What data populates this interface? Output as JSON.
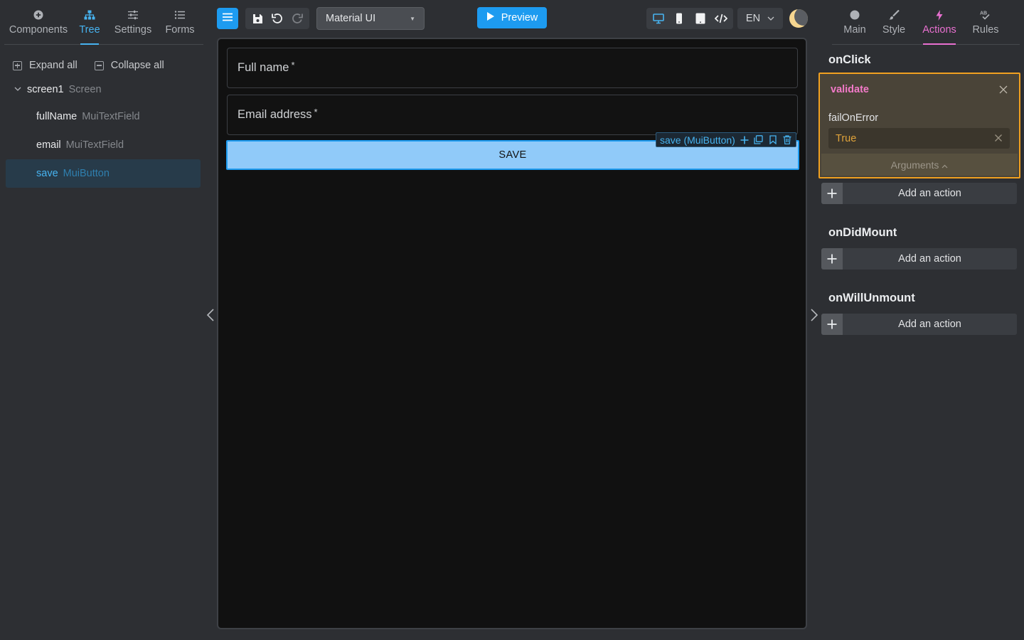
{
  "left_tabs": [
    {
      "label": "Components",
      "icon": "plus-circle-icon"
    },
    {
      "label": "Tree",
      "icon": "tree-icon"
    },
    {
      "label": "Settings",
      "icon": "sliders-icon"
    },
    {
      "label": "Forms",
      "icon": "list-icon"
    }
  ],
  "left_active_tab": "Tree",
  "tree_controls": {
    "expand_all": "Expand all",
    "collapse_all": "Collapse all"
  },
  "tree": {
    "root": {
      "name": "screen1",
      "type": "Screen"
    },
    "children": [
      {
        "name": "fullName",
        "type": "MuiTextField"
      },
      {
        "name": "email",
        "type": "MuiTextField"
      },
      {
        "name": "save",
        "type": "MuiButton",
        "selected": true
      }
    ]
  },
  "toolbar": {
    "library_select": "Material UI",
    "preview_label": "Preview",
    "language": "EN"
  },
  "canvas": {
    "fields": [
      {
        "label": "Full name",
        "required_mark": "*"
      },
      {
        "label": "Email address",
        "required_mark": "*"
      }
    ],
    "save_button": "SAVE",
    "selection_badge": "save (MuiButton)"
  },
  "right_tabs": [
    {
      "label": "Main",
      "icon": "circle-icon"
    },
    {
      "label": "Style",
      "icon": "brush-icon"
    },
    {
      "label": "Actions",
      "icon": "lightning-icon"
    },
    {
      "label": "Rules",
      "icon": "spellcheck-icon"
    }
  ],
  "right_active_tab": "Actions",
  "events": [
    {
      "name": "onClick",
      "actions": [
        {
          "name": "validate",
          "param_name": "failOnError",
          "param_value": "True",
          "arguments_label": "Arguments"
        }
      ],
      "add_label": "Add an action"
    },
    {
      "name": "onDidMount",
      "actions": [],
      "add_label": "Add an action"
    },
    {
      "name": "onWillUnmount",
      "actions": [],
      "add_label": "Add an action"
    }
  ],
  "colors": {
    "accent_blue": "#1d9bf0",
    "actions_pink": "#e870d0",
    "action_highlight": "#f0a020",
    "save_button_bg": "#90caf9"
  }
}
